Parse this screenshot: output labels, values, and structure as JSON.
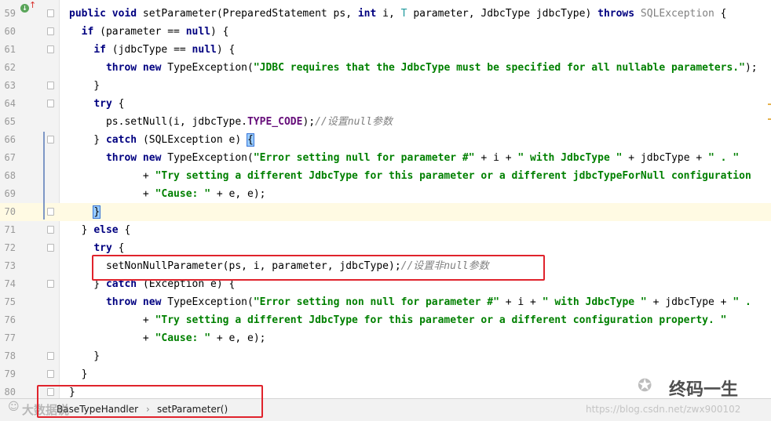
{
  "editor": {
    "lines": [
      {
        "no": "59",
        "tokens": [
          [
            "kw",
            "public void "
          ],
          [
            "",
            "setParameter(PreparedStatement ps, "
          ],
          [
            "kw",
            "int "
          ],
          [
            "",
            "i, "
          ],
          [
            "tp",
            "T "
          ],
          [
            "",
            "parameter, JdbcType jdbcType) "
          ],
          [
            "kw",
            "throws "
          ],
          [
            "dim",
            "SQLException "
          ],
          [
            "",
            "{"
          ]
        ]
      },
      {
        "no": "60",
        "tokens": [
          [
            "",
            "  "
          ],
          [
            "kw",
            "if "
          ],
          [
            "",
            "(parameter == "
          ],
          [
            "kw",
            "null"
          ],
          [
            "",
            ") {"
          ]
        ]
      },
      {
        "no": "61",
        "tokens": [
          [
            "",
            "    "
          ],
          [
            "kw",
            "if "
          ],
          [
            "",
            "(jdbcType == "
          ],
          [
            "kw",
            "null"
          ],
          [
            "",
            ") {"
          ]
        ]
      },
      {
        "no": "62",
        "tokens": [
          [
            "",
            "      "
          ],
          [
            "kw",
            "throw new "
          ],
          [
            "",
            "TypeException("
          ],
          [
            "str",
            "\"JDBC requires that the JdbcType must be specified for all nullable parameters.\""
          ],
          [
            "",
            ");"
          ]
        ]
      },
      {
        "no": "63",
        "tokens": [
          [
            "",
            "    }"
          ]
        ]
      },
      {
        "no": "64",
        "tokens": [
          [
            "",
            "    "
          ],
          [
            "kw",
            "try "
          ],
          [
            "",
            "{"
          ]
        ]
      },
      {
        "no": "65",
        "tokens": [
          [
            "",
            "      ps.setNull(i, jdbcType."
          ],
          [
            "fld",
            "TYPE_CODE"
          ],
          [
            "",
            ");"
          ],
          [
            "cmt",
            "//设置null参数"
          ]
        ]
      },
      {
        "no": "66",
        "tokens": [
          [
            "",
            "    } "
          ],
          [
            "kw",
            "catch "
          ],
          [
            "",
            "(SQLException e) "
          ],
          [
            "hl",
            "{"
          ]
        ]
      },
      {
        "no": "67",
        "tokens": [
          [
            "",
            "      "
          ],
          [
            "kw",
            "throw new "
          ],
          [
            "",
            "TypeException("
          ],
          [
            "str",
            "\"Error setting null for parameter #\" "
          ],
          [
            "",
            "+ i + "
          ],
          [
            "str",
            "\" with JdbcType \" "
          ],
          [
            "",
            "+ jdbcType + "
          ],
          [
            "str",
            "\" . \""
          ]
        ]
      },
      {
        "no": "68",
        "tokens": [
          [
            "",
            "            + "
          ],
          [
            "str",
            "\"Try setting a different JdbcType for this parameter or a different jdbcTypeForNull configuration"
          ]
        ]
      },
      {
        "no": "69",
        "tokens": [
          [
            "",
            "            + "
          ],
          [
            "str",
            "\"Cause: \" "
          ],
          [
            "",
            "+ e, e);"
          ]
        ]
      },
      {
        "no": "70",
        "tokens": [
          [
            "",
            "    "
          ],
          [
            "hl",
            "}"
          ]
        ]
      },
      {
        "no": "71",
        "tokens": [
          [
            "",
            "  } "
          ],
          [
            "kw",
            "else "
          ],
          [
            "",
            "{"
          ]
        ]
      },
      {
        "no": "72",
        "tokens": [
          [
            "",
            "    "
          ],
          [
            "kw",
            "try "
          ],
          [
            "",
            "{"
          ]
        ]
      },
      {
        "no": "73",
        "tokens": [
          [
            "",
            "      setNonNullParameter(ps, i, parameter, jdbcType);"
          ],
          [
            "cmt",
            "//设置非null参数"
          ]
        ]
      },
      {
        "no": "74",
        "tokens": [
          [
            "",
            "    } "
          ],
          [
            "kw",
            "catch "
          ],
          [
            "",
            "(Exception e) {"
          ]
        ]
      },
      {
        "no": "75",
        "tokens": [
          [
            "",
            "      "
          ],
          [
            "kw",
            "throw new "
          ],
          [
            "",
            "TypeException("
          ],
          [
            "str",
            "\"Error setting non null for parameter #\" "
          ],
          [
            "",
            "+ i + "
          ],
          [
            "str",
            "\" with JdbcType \" "
          ],
          [
            "",
            "+ jdbcType + "
          ],
          [
            "str",
            "\" . "
          ]
        ]
      },
      {
        "no": "76",
        "tokens": [
          [
            "",
            "            + "
          ],
          [
            "str",
            "\"Try setting a different JdbcType for this parameter or a different configuration property. \""
          ]
        ]
      },
      {
        "no": "77",
        "tokens": [
          [
            "",
            "            + "
          ],
          [
            "str",
            "\"Cause: \" "
          ],
          [
            "",
            "+ e, e);"
          ]
        ]
      },
      {
        "no": "78",
        "tokens": [
          [
            "",
            "    }"
          ]
        ]
      },
      {
        "no": "79",
        "tokens": [
          [
            "",
            "  }"
          ]
        ]
      },
      {
        "no": "80",
        "tokens": [
          [
            "",
            "}"
          ]
        ]
      }
    ],
    "current_line": "70"
  },
  "breadcrumb": {
    "class_name": "BaseTypeHandler",
    "separator": "›",
    "method_name": "setParameter()"
  },
  "watermarks": {
    "left_logo_text": "大数据说",
    "right_brand": "终码一生",
    "url": "https://blog.csdn.net/zwx900102"
  },
  "colors": {
    "keyword": "#000080",
    "string": "#008000",
    "comment": "#808080",
    "field": "#660e7a",
    "type_param": "#20999d",
    "current_line": "#fffae3",
    "annotation_box": "#e0232c"
  }
}
